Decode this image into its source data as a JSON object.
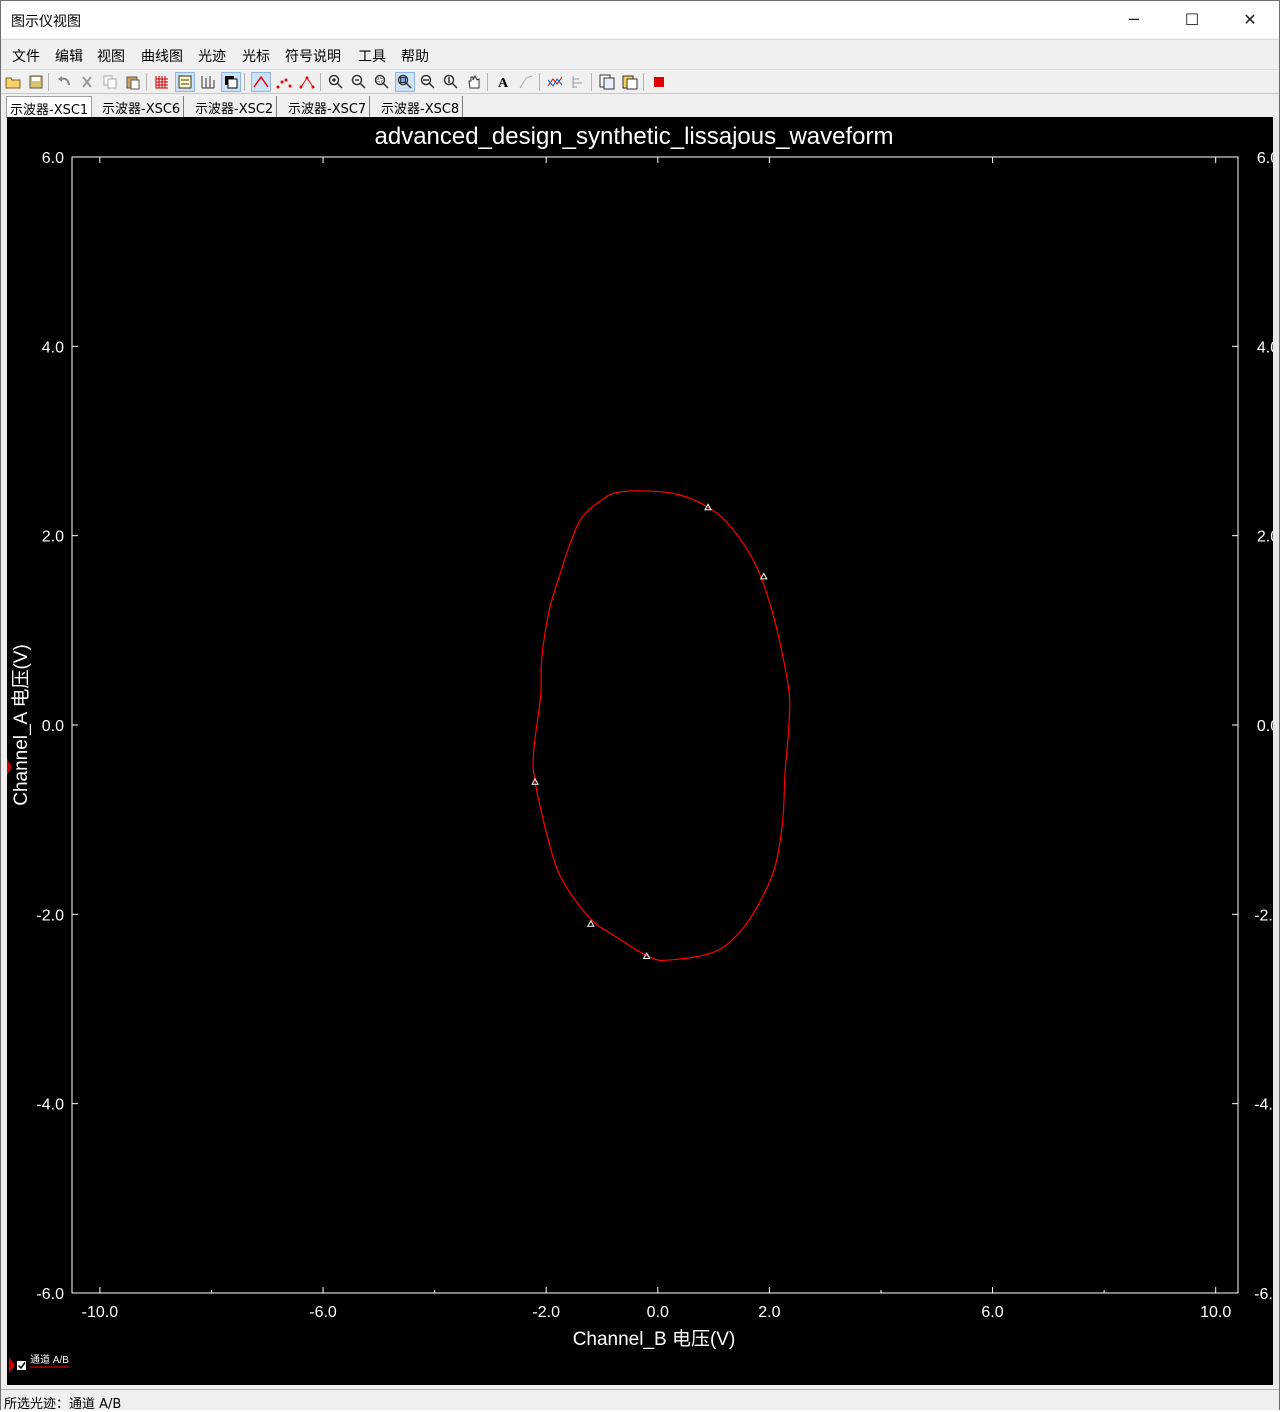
{
  "window": {
    "title": "图示仪视图",
    "controls": [
      "─",
      "☐",
      "✕"
    ]
  },
  "menu": [
    "文件",
    "编辑",
    "视图",
    "曲线图",
    "光迹",
    "光标",
    "符号说明",
    "工具",
    "帮助"
  ],
  "toolbar": {
    "icons": [
      "open-icon",
      "save-icon",
      "undo-icon",
      "cut-icon",
      "copy-icon",
      "paste-icon",
      "grid-icon",
      "legend-icon",
      "cursor-icon",
      "invert-icon",
      "line-trace-icon",
      "dots-trace-icon",
      "line-dots-trace-icon",
      "zoom-in-icon",
      "zoom-out-icon",
      "zoom-area-icon",
      "zoom-full-icon",
      "zoom-x-icon",
      "zoom-y-icon",
      "pan-icon",
      "text-icon",
      "label-icon",
      "overlay-icon",
      "export-icon",
      "copy-graph-icon",
      "paste-graph-icon",
      "stop-icon"
    ]
  },
  "tabs": [
    "示波器-XSC1",
    "示波器-XSC6",
    "示波器-XSC2",
    "示波器-XSC7",
    "示波器-XSC8"
  ],
  "chart_data": {
    "type": "line",
    "title": "advanced_design_synthetic_lissajous_waveform",
    "xlabel": "Channel_B 电压(V)",
    "ylabel": "Channel_A 电压(V)",
    "xlim": [
      -10.5,
      10.4
    ],
    "ylim": [
      -6.0,
      6.0
    ],
    "x_ticks": [
      "-10.0",
      "-6.0",
      "-2.0",
      "0.0",
      "2.0",
      "6.0",
      "10.0"
    ],
    "x_tick_values": [
      -10,
      -6,
      -2,
      0,
      2,
      6,
      10
    ],
    "y_ticks": [
      "6.0",
      "4.0",
      "2.0",
      "0.0",
      "-2.0",
      "-4.0",
      "-6.0"
    ],
    "y_tick_values": [
      6,
      4,
      2,
      0,
      -2,
      -4,
      -6
    ],
    "grid": false,
    "legend": "bottom-left",
    "series": [
      {
        "name": "通道 A/B",
        "color": "#ff0000",
        "x": [
          -0.1,
          0.4,
          0.9,
          1.3,
          1.75,
          2.05,
          2.25,
          2.36,
          2.34,
          2.28,
          2.24,
          2.1,
          1.8,
          1.45,
          1.0,
          0.25,
          -0.15,
          -0.85,
          -1.2,
          -1.65,
          -1.9,
          -2.2,
          -2.22,
          -2.1,
          -2.08,
          -1.95,
          -1.75,
          -1.55,
          -1.35,
          -1.0,
          -0.7,
          -0.1
        ],
        "y": [
          2.47,
          2.43,
          2.3,
          2.1,
          1.7,
          1.2,
          0.7,
          0.3,
          -0.1,
          -0.5,
          -1.0,
          -1.5,
          -1.9,
          -2.2,
          -2.4,
          -2.48,
          -2.45,
          -2.2,
          -2.05,
          -1.7,
          -1.35,
          -0.6,
          -0.25,
          0.3,
          0.7,
          1.2,
          1.6,
          1.95,
          2.2,
          2.38,
          2.46,
          2.47
        ]
      }
    ],
    "markers": {
      "x": [
        0.9,
        1.9,
        -2.2,
        -1.2,
        -0.2
      ],
      "y": [
        2.3,
        1.57,
        -0.6,
        -2.1,
        -2.44
      ]
    },
    "legend_entry": "通道 A/B"
  },
  "status": {
    "text": "所选光迹：通道 A/B"
  }
}
